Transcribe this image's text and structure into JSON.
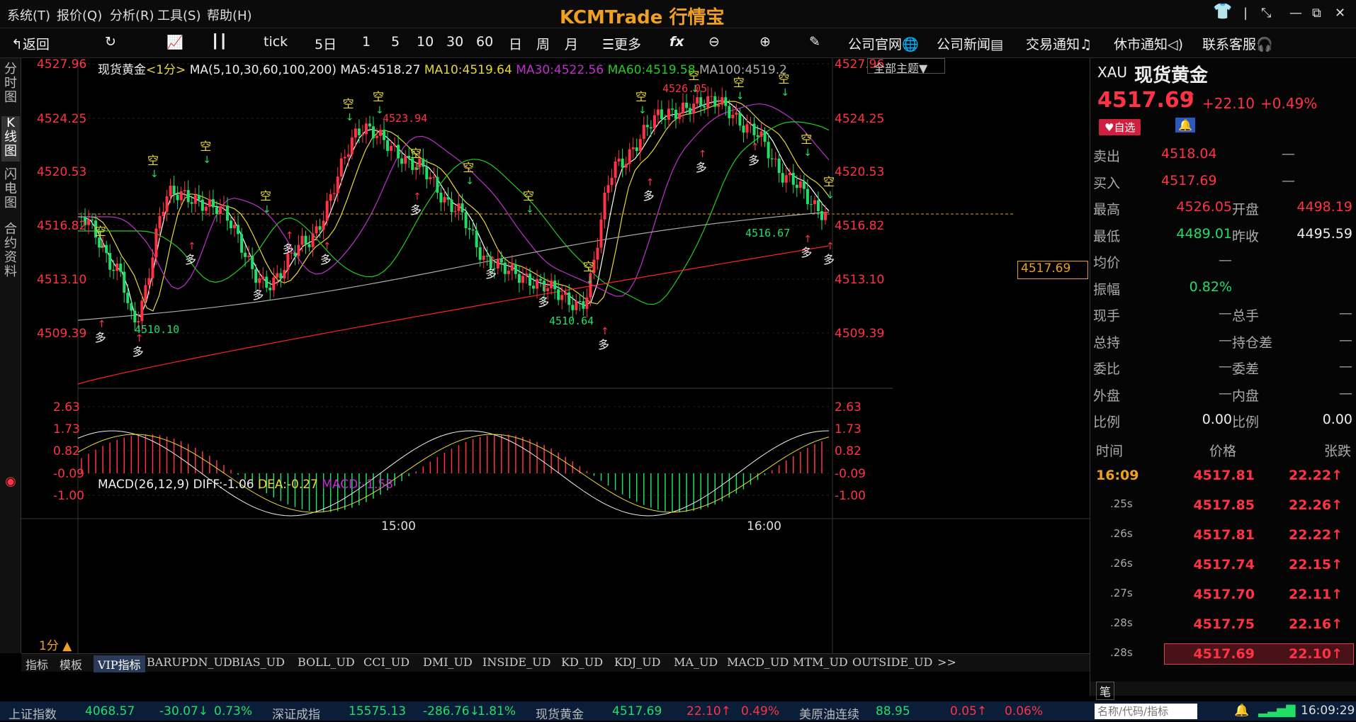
{
  "menu": [
    "系统(T)",
    "报价(Q)",
    "分析(R)",
    "工具(S)",
    "帮助(H)"
  ],
  "brand": "KCMTrade 行情宝",
  "toolbar": {
    "back": "返回",
    "items": [
      "tick",
      "5日",
      "1",
      "5",
      "10",
      "30",
      "60",
      "日",
      "周",
      "月"
    ],
    "more": "更多",
    "fx": "fx",
    "links": [
      "公司官网",
      "公司新闻",
      "交易通知",
      "休市通知",
      "联系客服"
    ]
  },
  "left_tabs": [
    "分时图",
    "K线图",
    "闪电图",
    "合约资料"
  ],
  "chart_legend": {
    "name": "现货黄金",
    "period": "<1分>",
    "ma": "MA(5,10,30,60,100,200)",
    "ma5": "MA5:4518.27",
    "ma10": "MA10:4519.64",
    "ma30": "MA30:4522.56",
    "ma60": "MA60:4519.58",
    "ma100": "MA100:4519.2",
    "theme": "全部主题▼"
  },
  "macd_legend": {
    "name": "MACD(26,12,9)",
    "diff": "DIFF:-1.06",
    "dea": "DEA:-0.27",
    "macd": "MACD:-1.58"
  },
  "period_label": "1分 ▲",
  "price_labels": [
    "4527.96",
    "4524.25",
    "4520.53",
    "4516.82",
    "4513.10",
    "4509.39"
  ],
  "macd_labels": [
    "2.63",
    "1.73",
    "0.82",
    "-0.09",
    "-1.00"
  ],
  "time_labels": [
    "15:00",
    "16:00"
  ],
  "current_price_tag": "4517.69",
  "annotations": {
    "high": "4526.05",
    "h2": "4523.94",
    "low1": "4510.10",
    "low2": "4510.64",
    "low3": "4516.67",
    "short": "空",
    "long": "多"
  },
  "tabs": [
    "指标",
    "模板",
    "VIP指标",
    "BARUPDN_UD",
    "BIAS_UD",
    "BOLL_UD",
    "CCI_UD",
    "DMI_UD",
    "INSIDE_UD",
    "KD_UD",
    "KDJ_UD",
    "MA_UD",
    "MACD_UD",
    "MTM_UD",
    "OUTSIDE_UD",
    ">>"
  ],
  "quote": {
    "code": "XAU",
    "name": "现货黄金",
    "price": "4517.69",
    "arrow": "↑",
    "change": "+22.10",
    "pct": "+0.49%",
    "fav": "自选",
    "rows": [
      [
        "卖出",
        "4518.04",
        "—"
      ],
      [
        "买入",
        "4517.69",
        "—"
      ]
    ],
    "grid": [
      [
        "最高",
        "4526.05",
        "开盘",
        "4498.19"
      ],
      [
        "最低",
        "4489.01",
        "昨收",
        "4495.59"
      ],
      [
        "均价",
        "—",
        "",
        ""
      ],
      [
        "振幅",
        "0.82%",
        "",
        ""
      ],
      [
        "现手",
        "—",
        "总手",
        "—"
      ],
      [
        "总持",
        "—",
        "持仓差",
        "—"
      ],
      [
        "委比",
        "—",
        "委差",
        "—"
      ],
      [
        "外盘",
        "—",
        "内盘",
        "—"
      ],
      [
        "比例",
        "0.00",
        "比例",
        "0.00"
      ]
    ],
    "trades_header": [
      "时间",
      "价格",
      "张跌"
    ],
    "trades": [
      [
        "16:09",
        "4517.81",
        "22.22"
      ],
      [
        ".25s",
        "4517.85",
        "22.26"
      ],
      [
        ".26s",
        "4517.81",
        "22.22"
      ],
      [
        ".26s",
        "4517.74",
        "22.15"
      ],
      [
        ".27s",
        "4517.70",
        "22.11"
      ],
      [
        ".28s",
        "4517.75",
        "22.16"
      ],
      [
        ".28s",
        "4517.69",
        "22.10"
      ]
    ],
    "pen": "笔",
    "search_placeholder": "名称/代码/指标"
  },
  "status": [
    [
      "上证指数",
      "4068.57",
      "-30.07↓",
      "0.73%"
    ],
    [
      "深证成指",
      "15575.13",
      "-286.76↓",
      "1.81%"
    ],
    [
      "现货黄金",
      "4517.69",
      "22.10↑",
      "0.49%"
    ],
    [
      "美原油连续",
      "88.95",
      "0.05↑",
      "0.06%"
    ]
  ],
  "clock": "16:09:29",
  "colors": {
    "up": "#ff3344",
    "down": "#22dd66",
    "ma5": "#ffffff",
    "ma10": "#e8d838",
    "ma30": "#c030d0",
    "ma60": "#22cc22",
    "ma100": "#aaaaaa",
    "ma200": "#ff2222"
  }
}
